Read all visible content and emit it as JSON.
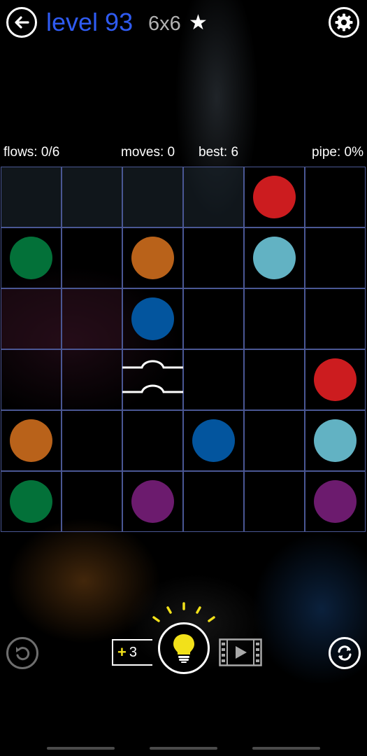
{
  "header": {
    "level_label": "level 93",
    "size_label": "6x6",
    "star": "★",
    "back_icon": "back-arrow-icon",
    "settings_icon": "gear-icon"
  },
  "stats": {
    "flows": "flows: 0/6",
    "moves": "moves: 0",
    "best": "best: 6",
    "pipe": "pipe: 0%"
  },
  "board": {
    "rows": 6,
    "cols": 6,
    "grid_color": "#4a5794",
    "dots": [
      {
        "row": 0,
        "col": 4,
        "color": "#cc1c1f"
      },
      {
        "row": 1,
        "col": 0,
        "color": "#037139"
      },
      {
        "row": 1,
        "col": 2,
        "color": "#b9621a"
      },
      {
        "row": 1,
        "col": 4,
        "color": "#62b2c3"
      },
      {
        "row": 2,
        "col": 2,
        "color": "#03559e"
      },
      {
        "row": 3,
        "col": 5,
        "color": "#cc1c1f"
      },
      {
        "row": 4,
        "col": 0,
        "color": "#b9621a"
      },
      {
        "row": 4,
        "col": 3,
        "color": "#03559e"
      },
      {
        "row": 4,
        "col": 5,
        "color": "#62b2c3"
      },
      {
        "row": 5,
        "col": 0,
        "color": "#037139"
      },
      {
        "row": 5,
        "col": 2,
        "color": "#6c1b6e"
      },
      {
        "row": 5,
        "col": 5,
        "color": "#6c1b6e"
      }
    ],
    "bridges": [
      {
        "row": 3,
        "col": 2
      }
    ]
  },
  "controls": {
    "hint_plus": "+",
    "hint_count": "3",
    "undo_icon": "undo-icon",
    "hint_icon": "lightbulb-icon",
    "video_icon": "video-film-icon",
    "reset_icon": "refresh-icon",
    "accent": "#f2e11a"
  }
}
